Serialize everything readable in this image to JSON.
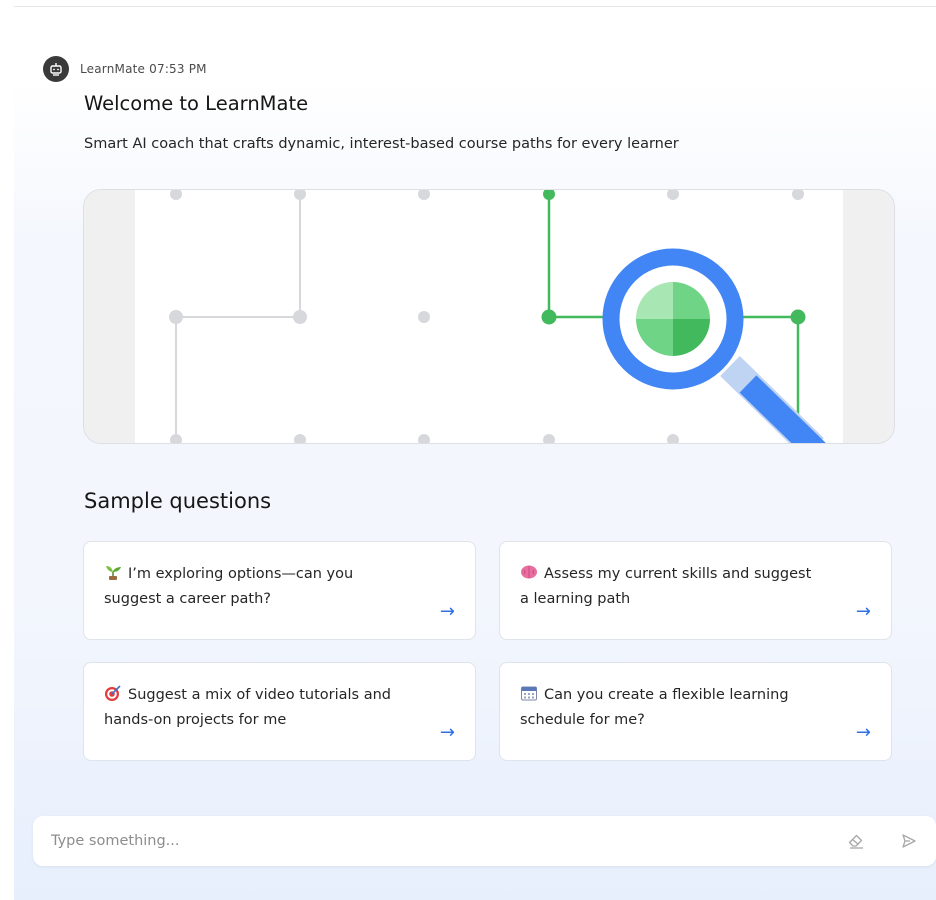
{
  "message": {
    "sender": "LearnMate",
    "time": "07:53 PM",
    "header_text": "LearnMate 07:53 PM",
    "avatar_icon": "robot-icon",
    "title": "Welcome to LearnMate",
    "subtitle": "Smart AI coach that crafts dynamic, interest-based course paths for every learner",
    "illustration_icon": "magnifying-glass-path-illustration"
  },
  "sample_questions": {
    "title": "Sample questions",
    "items": [
      {
        "emoji": "seedling-icon",
        "text": "I’m exploring options—can you suggest a career path?"
      },
      {
        "emoji": "brain-icon",
        "text": "Assess my current skills and suggest a learning path"
      },
      {
        "emoji": "target-icon",
        "text": "Suggest a mix of video tutorials and hands-on projects for me"
      },
      {
        "emoji": "calendar-icon",
        "text": "Can you create a flexible learning schedule for me?"
      }
    ],
    "arrow_icon": "arrow-right-icon"
  },
  "composer": {
    "placeholder": "Type something...",
    "value": "",
    "clear_icon": "eraser-icon",
    "send_icon": "send-icon"
  },
  "colors": {
    "accent": "#2f6fe0",
    "green": "#42b95c",
    "lens_blue": "#4285f4",
    "text": "#161616"
  }
}
